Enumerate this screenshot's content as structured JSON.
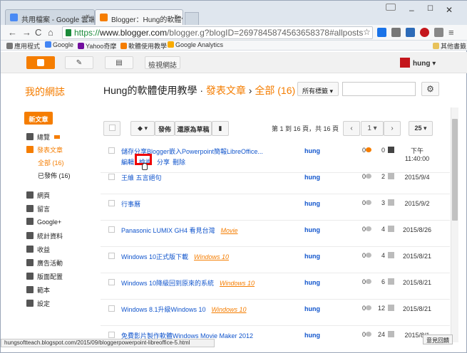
{
  "browser": {
    "tabs": [
      {
        "title": "共用檔案 - Google 雲端硬碟",
        "icon_color": "#4a8af4"
      },
      {
        "title": "Blogger：Hung的軟體使用教學",
        "icon_color": "#f57d00"
      }
    ],
    "url_scheme": "https://",
    "url_host": "www.blogger.com",
    "url_path": "/blogger.g?blogID=2697845874563658378#allposts",
    "bookmarks": [
      {
        "label": "應用程式",
        "icon_color": "#777"
      },
      {
        "label": "Google",
        "icon_color": "#4285f4"
      },
      {
        "label": "Yahoo奇摩",
        "icon_color": "#720e9e"
      },
      {
        "label": "軟體使用教學",
        "icon_color": "#f57d00"
      },
      {
        "label": "Google Analytics",
        "icon_color": "#f9ab00"
      }
    ],
    "other_bookmarks": "其他書籤"
  },
  "header": {
    "view_blog": "檢視網誌",
    "user": "hung"
  },
  "blog": {
    "sidebar_title": "我的網誌",
    "crumb_blog": "Hung的軟體使用教學",
    "crumb_section": "發表文章",
    "crumb_filter": "全部 (16)",
    "labels_btn": "所有標籤"
  },
  "sidebar": {
    "new_post": "新文章",
    "items": [
      {
        "label": "總覽"
      },
      {
        "label": "發表文章"
      },
      {
        "label": "全部 (16)"
      },
      {
        "label": "已發佈 (16)"
      },
      {
        "label": "網頁"
      },
      {
        "label": "留言"
      },
      {
        "label": "Google+"
      },
      {
        "label": "統計資料"
      },
      {
        "label": "收益"
      },
      {
        "label": "廣告活動"
      },
      {
        "label": "版面配置"
      },
      {
        "label": "範本"
      },
      {
        "label": "設定"
      }
    ]
  },
  "toolbar": {
    "publish": "發佈",
    "revert": "還原為草稿",
    "page_info": "第 1 到 16 頁，共 16 頁",
    "page": "1",
    "per_page": "25"
  },
  "posts": [
    {
      "title": "儲存分享Blogger嵌入Powerpoint簡報LibreOffice...",
      "label": "",
      "author": "hung",
      "comments": "0",
      "views": "0",
      "date": "下午",
      "date2": "11:40:00",
      "edit": "編輯",
      "preview": "檢視",
      "share": "分享",
      "delete": "刪除"
    },
    {
      "title": "王維 五言絕句",
      "label": "",
      "author": "hung",
      "comments": "0",
      "views": "2",
      "date": "2015/9/4",
      "date2": ""
    },
    {
      "title": "行事曆",
      "label": "",
      "author": "hung",
      "comments": "0",
      "views": "3",
      "date": "2015/9/2",
      "date2": ""
    },
    {
      "title": "Panasonic LUMIX GH4 看見台灣",
      "label": "Movie",
      "author": "hung",
      "comments": "0",
      "views": "4",
      "date": "2015/8/26",
      "date2": ""
    },
    {
      "title": "Windows 10正式版下載",
      "label": "Windows 10",
      "author": "hung",
      "comments": "0",
      "views": "4",
      "date": "2015/8/21",
      "date2": ""
    },
    {
      "title": "Windows 10降級回到原來的系統",
      "label": "Windows 10",
      "author": "hung",
      "comments": "0",
      "views": "6",
      "date": "2015/8/21",
      "date2": ""
    },
    {
      "title": "Windows 8.1升級Windows 10",
      "label": "Windows 10",
      "author": "hung",
      "comments": "0",
      "views": "12",
      "date": "2015/8/21",
      "date2": ""
    },
    {
      "title": "免費影片製作軟體Windows Movie Maker 2012",
      "label": "",
      "author": "hung",
      "comments": "0",
      "views": "24",
      "date": "2015/8/1",
      "date2": ""
    }
  ],
  "status_url": "hungsoftteach.blogspot.com/2015/09/bloggerpowerpoint-libreoffice-5.html",
  "feedback": "意見回饋",
  "colors": {
    "accent": "#f57d00",
    "link": "#1155cc"
  }
}
